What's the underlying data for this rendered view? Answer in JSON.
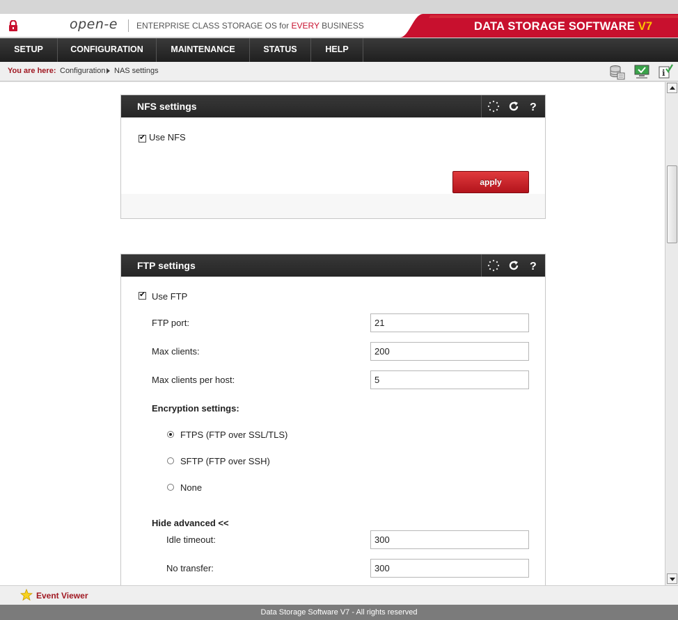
{
  "header": {
    "logo": "open-e",
    "tagline_prefix": "ENTERPRISE CLASS STORAGE OS for ",
    "tagline_highlight": "EVERY",
    "tagline_suffix": " BUSINESS",
    "brand": "DATA STORAGE SOFTWARE ",
    "brand_version": "V7"
  },
  "menu": {
    "items": [
      {
        "label": "SETUP"
      },
      {
        "label": "CONFIGURATION"
      },
      {
        "label": "MAINTENANCE"
      },
      {
        "label": "STATUS"
      },
      {
        "label": "HELP"
      }
    ]
  },
  "breadcrumb": {
    "label": "You are here:",
    "items": [
      "Configuration",
      "NAS settings"
    ]
  },
  "nfs_panel": {
    "title": "NFS settings",
    "use_label": "Use NFS",
    "use_checked": true,
    "apply_label": "apply"
  },
  "ftp_panel": {
    "title": "FTP settings",
    "use_label": "Use FTP",
    "use_checked": true,
    "port_label": "FTP port:",
    "port_value": "21",
    "max_clients_label": "Max clients:",
    "max_clients_value": "200",
    "max_per_host_label": "Max clients per host:",
    "max_per_host_value": "5",
    "encryption_heading": "Encryption settings:",
    "encryption_options": [
      {
        "label": "FTPS (FTP over SSL/TLS)",
        "selected": true
      },
      {
        "label": "SFTP (FTP over SSH)",
        "selected": false
      },
      {
        "label": "None",
        "selected": false
      }
    ],
    "advanced_toggle": "Hide advanced <<",
    "idle_timeout_label": "Idle timeout:",
    "idle_timeout_value": "300",
    "no_transfer_label": "No transfer:",
    "no_transfer_value": "300"
  },
  "event_viewer": {
    "label": "Event Viewer"
  },
  "footer": {
    "text": "Data Storage Software V7 - All rights reserved"
  },
  "colors": {
    "brand_red": "#c8102e",
    "menu_dark": "#262626",
    "version_yellow": "#ffc300",
    "crumb_red": "#a01822"
  }
}
